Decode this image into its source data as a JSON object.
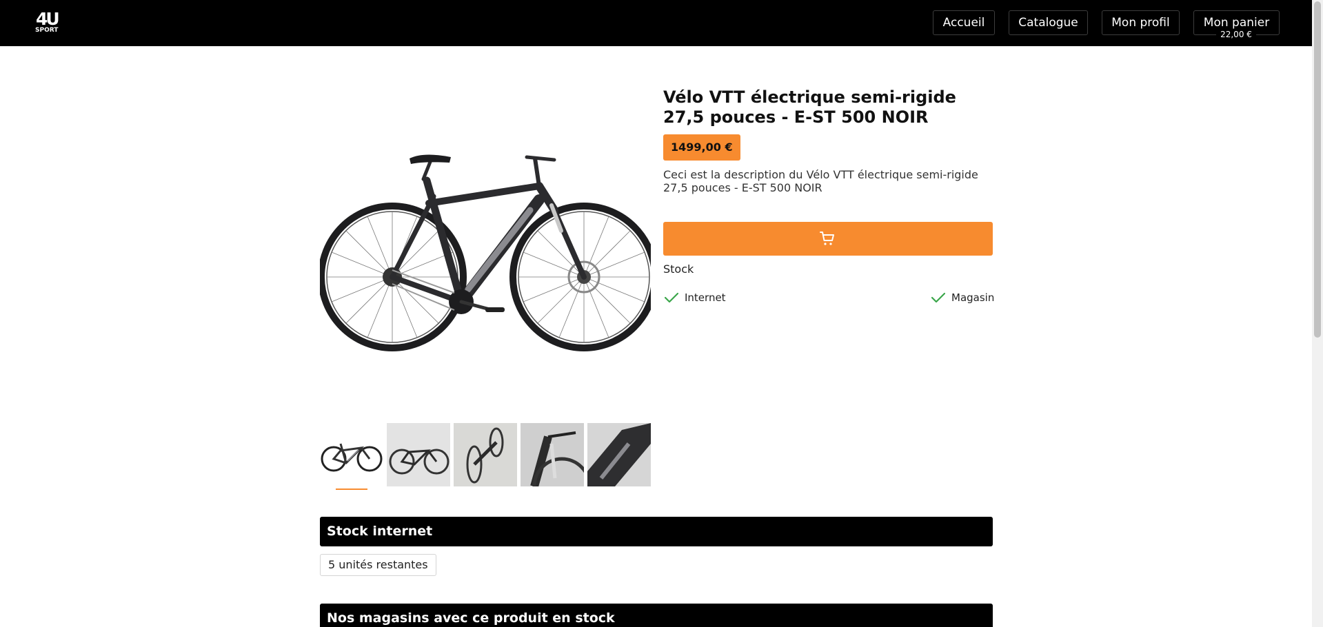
{
  "header": {
    "logo": {
      "big": "4U",
      "small": "SPORT"
    },
    "nav": [
      {
        "label": "Accueil"
      },
      {
        "label": "Catalogue"
      },
      {
        "label": "Mon profil"
      },
      {
        "label": "Mon panier"
      }
    ],
    "cart_total": "22,00 €"
  },
  "product": {
    "title": "Vélo VTT électrique semi-rigide 27,5 pouces - E-ST 500 NOIR",
    "price": "1499,00 €",
    "description": "Ceci est la description du Vélo VTT électrique semi-rigide 27,5 pouces - E-ST 500 NOIR",
    "add_to_cart_icon": "shopping-cart-icon",
    "stock_label": "Stock",
    "availability": [
      {
        "label": "Internet",
        "available": true
      },
      {
        "label": "Magasin",
        "available": true
      }
    ],
    "thumbnails": [
      "bike-side-view",
      "bike-studio-shot",
      "bike-rear-angle",
      "bike-fork-detail",
      "bike-frame-detail"
    ],
    "active_thumbnail": 0
  },
  "sections": {
    "stock_internet_title": "Stock internet",
    "units_remaining": "5 unités restantes",
    "stores_title": "Nos magasins avec ce produit en stock"
  },
  "colors": {
    "accent": "#f78b2f",
    "header_bg": "#000000",
    "check": "#3aa64a"
  }
}
